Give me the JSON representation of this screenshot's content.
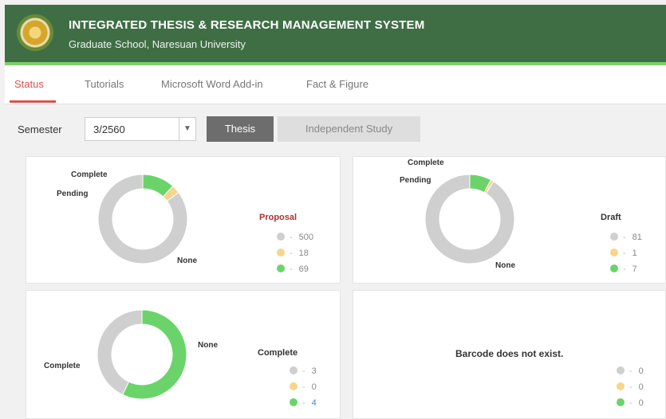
{
  "header": {
    "title": "INTEGRATED THESIS & RESEARCH MANAGEMENT SYSTEM",
    "subtitle": "Graduate School, Naresuan University"
  },
  "tabs": [
    {
      "label": "Status"
    },
    {
      "label": "Tutorials"
    },
    {
      "label": "Microsoft Word Add-in"
    },
    {
      "label": "Fact & Figure"
    }
  ],
  "filter": {
    "label": "Semester",
    "value": "3/2560",
    "buttons": [
      {
        "label": "Thesis"
      },
      {
        "label": "Independent Study"
      }
    ]
  },
  "colors": {
    "none": "#cfcfcf",
    "pending": "#f7d58a",
    "complete": "#6ad46a",
    "header": "#3f6e45",
    "active_tab": "#d9534f"
  },
  "cards": [
    {
      "legend_title": "Proposal",
      "labels": [
        "Complete",
        "Pending",
        "None"
      ],
      "legend": [
        {
          "color": "none",
          "value": "500"
        },
        {
          "color": "pending",
          "value": "18"
        },
        {
          "color": "complete",
          "value": "69"
        }
      ]
    },
    {
      "legend_title": "Draft",
      "labels": [
        "Complete",
        "Pending",
        "None"
      ],
      "legend": [
        {
          "color": "none",
          "value": "81"
        },
        {
          "color": "pending",
          "value": "1"
        },
        {
          "color": "complete",
          "value": "7"
        }
      ]
    },
    {
      "legend_title": "Complete",
      "labels": [
        "None",
        "Complete"
      ],
      "legend": [
        {
          "color": "none",
          "value": "3"
        },
        {
          "color": "pending",
          "value": "0"
        },
        {
          "color": "complete",
          "value": "4"
        }
      ]
    },
    {
      "message": "Barcode does not exist.",
      "legend": [
        {
          "color": "none",
          "value": "0"
        },
        {
          "color": "pending",
          "value": "0"
        },
        {
          "color": "complete",
          "value": "0"
        }
      ]
    }
  ]
}
